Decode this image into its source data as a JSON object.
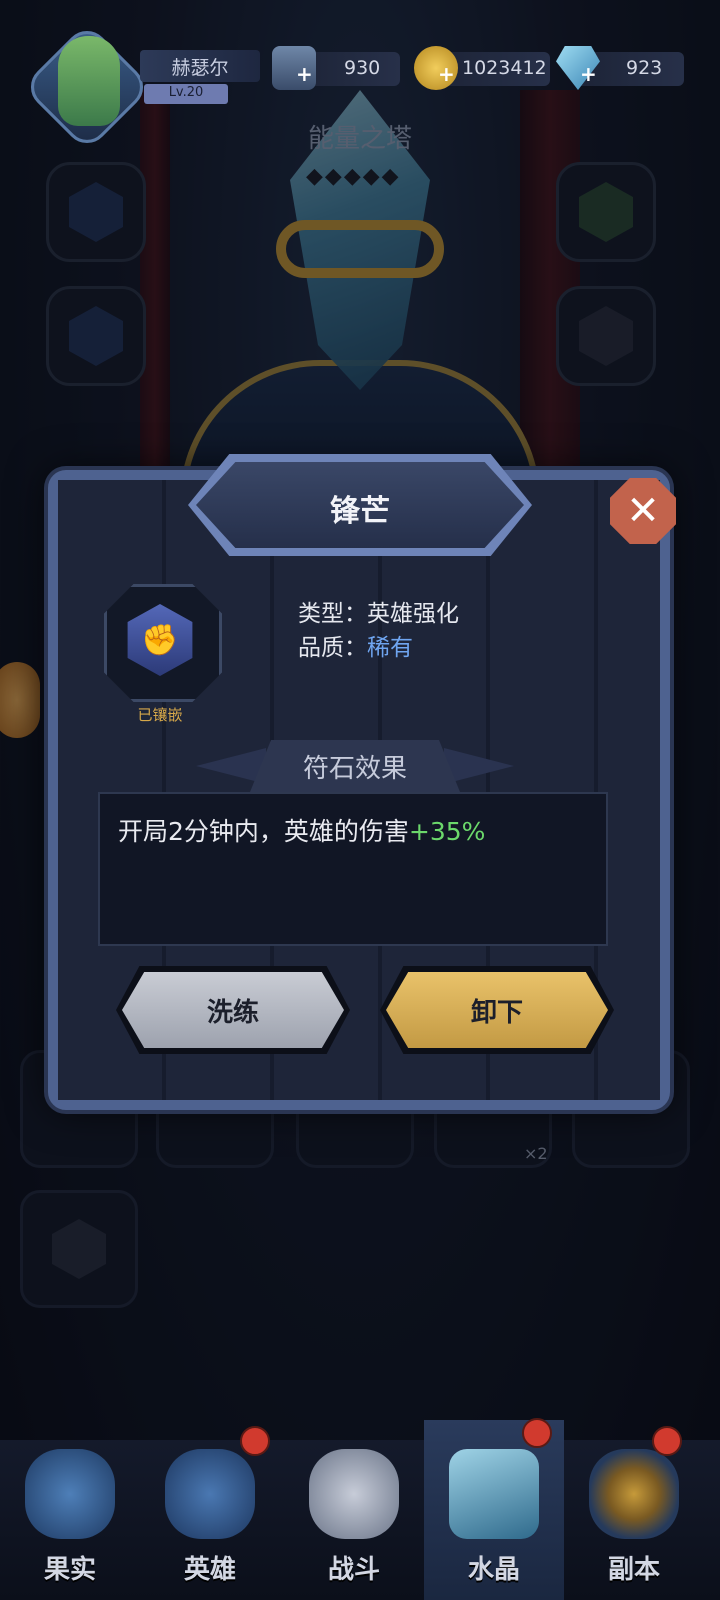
{
  "player": {
    "name": "赫瑟尔",
    "level": "Lv.20"
  },
  "resources": {
    "stamina": {
      "value": "930",
      "icon": "crystal-shard-icon"
    },
    "gold": {
      "value": "1023412",
      "icon": "gold-coin-icon"
    },
    "diamond": {
      "value": "923",
      "icon": "diamond-icon"
    }
  },
  "tower": {
    "title": "能量之塔"
  },
  "modal": {
    "title": "锋芒",
    "rune_status": "已镶嵌",
    "type_label": "类型：",
    "type_value": "英雄强化",
    "quality_label": "品质：",
    "quality_value": "稀有",
    "section_title": "符石效果",
    "effect_text": "开局2分钟内，英雄的伤害",
    "effect_bonus": "+35%",
    "reroll_button": "洗练",
    "unequip_button": "卸下",
    "close_icon": "close-icon"
  },
  "inventory": {
    "count_badge": "×2"
  },
  "nav": {
    "items": [
      {
        "label": "果实",
        "icon": "fruit-icon"
      },
      {
        "label": "英雄",
        "icon": "hero-icon"
      },
      {
        "label": "战斗",
        "icon": "battle-icon"
      },
      {
        "label": "水晶",
        "icon": "crystal-icon"
      },
      {
        "label": "副本",
        "icon": "dungeon-icon"
      }
    ],
    "active": "水晶"
  },
  "colors": {
    "rarity_rare": "#6fa5f0",
    "bonus_green": "#6bd86b",
    "accent_gold": "#c39a44",
    "close_red": "#c2634c"
  }
}
